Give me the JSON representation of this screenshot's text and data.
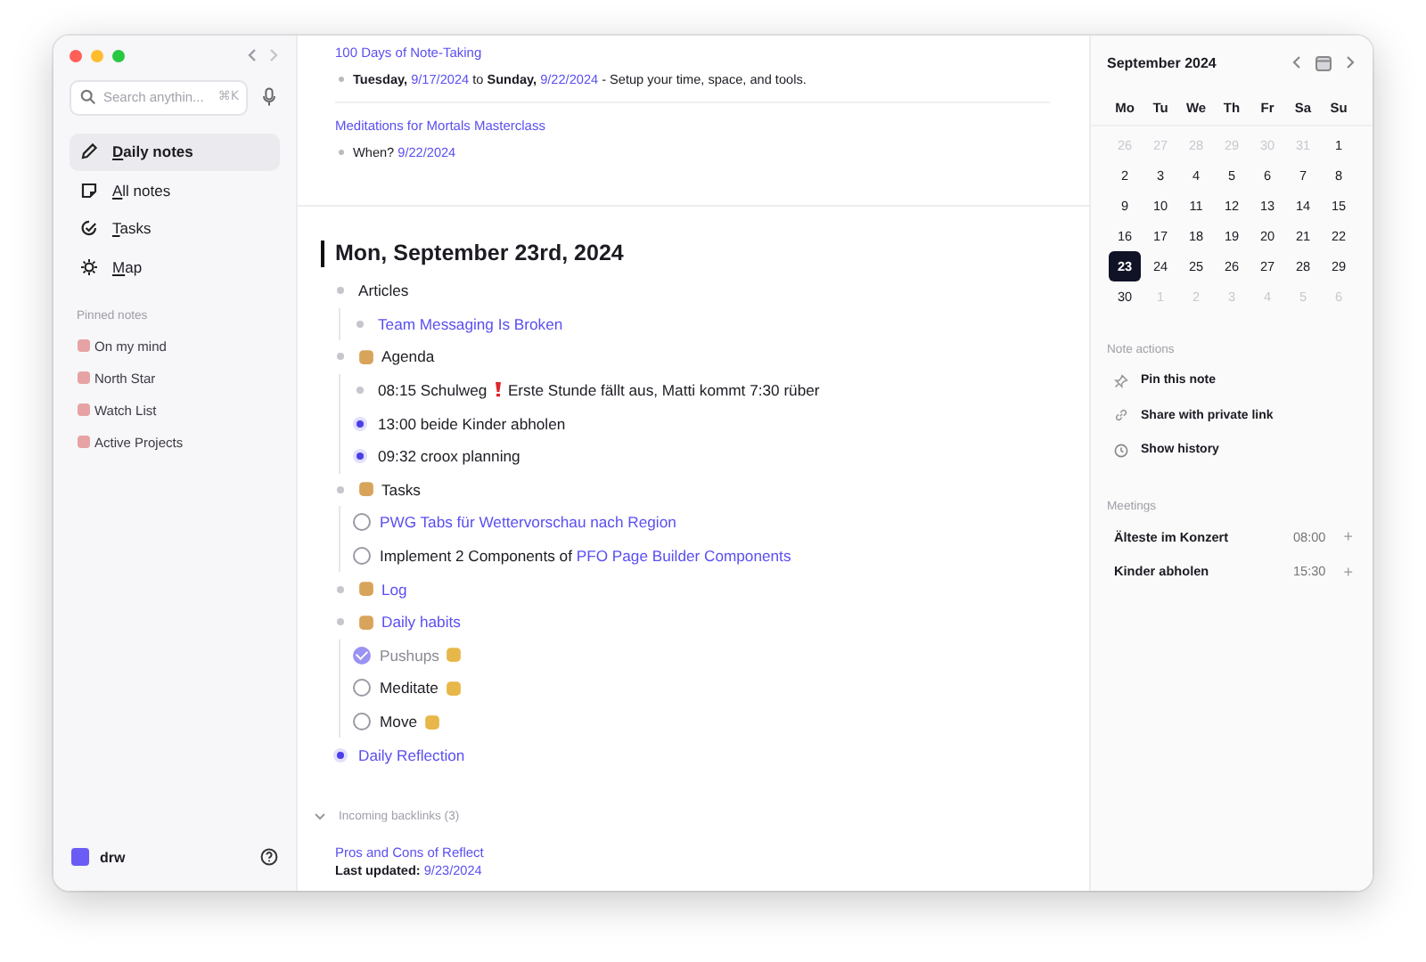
{
  "sidebar": {
    "search": {
      "placeholder": "Search anythin...",
      "shortcut": "⌘K"
    },
    "nav": [
      {
        "label": "Daily notes",
        "selected": true,
        "kind": "pencil"
      },
      {
        "label": "All notes",
        "selected": false,
        "kind": "note"
      },
      {
        "label": "Tasks",
        "selected": false,
        "kind": "tasks"
      },
      {
        "label": "Map",
        "selected": false,
        "kind": "map"
      }
    ],
    "pinned_heading": "Pinned notes",
    "pinned": [
      "On my mind",
      "North Star",
      "Watch List",
      "Active Projects"
    ],
    "user": "drw"
  },
  "previous_notes": [
    {
      "title": "100 Days of Note-Taking",
      "parts": [
        {
          "kind": "bold",
          "text": "Tuesday,"
        },
        {
          "kind": "link",
          "text": "9/17/2024"
        },
        {
          "kind": "text",
          "text": "to"
        },
        {
          "kind": "bold",
          "text": "Sunday,"
        },
        {
          "kind": "link",
          "text": "9/22/2024"
        },
        {
          "kind": "text",
          "text": "- Setup your time, space, and tools."
        }
      ]
    },
    {
      "title": "Meditations for Mortals Masterclass",
      "parts": [
        {
          "kind": "text",
          "text": "When?"
        },
        {
          "kind": "link",
          "text": "9/22/2024"
        }
      ]
    }
  ],
  "daily_note": {
    "title": "Mon, September 23rd, 2024",
    "outline": [
      {
        "kind": "bullet",
        "collapsed": false,
        "parts": [
          {
            "kind": "text",
            "text": "Articles"
          }
        ],
        "children": [
          {
            "kind": "bullet",
            "collapsed": false,
            "parts": [
              {
                "kind": "link",
                "text": "Team Messaging Is Broken"
              }
            ]
          }
        ]
      },
      {
        "kind": "emoji",
        "collapsed": false,
        "parts": [
          {
            "kind": "text",
            "text": "Agenda"
          }
        ],
        "children": [
          {
            "kind": "bullet",
            "collapsed": false,
            "parts": [
              {
                "kind": "text",
                "text": "08:15 Schulweg"
              },
              {
                "kind": "alert"
              },
              {
                "kind": "text",
                "text": "Erste Stunde fällt aus, Matti kommt 7:30 rüber"
              }
            ]
          },
          {
            "kind": "bullet",
            "collapsed": true,
            "parts": [
              {
                "kind": "text",
                "text": "13:00 beide Kinder abholen"
              }
            ]
          },
          {
            "kind": "bullet",
            "collapsed": true,
            "parts": [
              {
                "kind": "text",
                "text": "09:32 croox planning"
              }
            ]
          }
        ]
      },
      {
        "kind": "emoji",
        "collapsed": false,
        "parts": [
          {
            "kind": "text",
            "text": "Tasks"
          }
        ],
        "children": [
          {
            "kind": "task",
            "checked": false,
            "parts": [
              {
                "kind": "link",
                "text": "PWG Tabs für Wettervorschau nach Region"
              }
            ]
          },
          {
            "kind": "task",
            "checked": false,
            "parts": [
              {
                "kind": "text",
                "text": "Implement 2 Components of"
              },
              {
                "kind": "link",
                "text": "PFO Page Builder Components"
              }
            ]
          }
        ]
      },
      {
        "kind": "emoji",
        "collapsed": false,
        "parts": [
          {
            "kind": "link",
            "text": "Log"
          }
        ]
      },
      {
        "kind": "emoji",
        "collapsed": false,
        "parts": [
          {
            "kind": "link",
            "text": "Daily habits"
          }
        ],
        "children": [
          {
            "kind": "habit",
            "checked": true,
            "parts": [
              {
                "kind": "text",
                "text": "Pushups"
              }
            ]
          },
          {
            "kind": "habit",
            "checked": false,
            "parts": [
              {
                "kind": "text",
                "text": "Meditate"
              }
            ]
          },
          {
            "kind": "habit",
            "checked": false,
            "parts": [
              {
                "kind": "text",
                "text": "Move"
              }
            ]
          }
        ]
      },
      {
        "kind": "bullet",
        "collapsed": true,
        "parts": [
          {
            "kind": "link",
            "text": "Daily Reflection"
          }
        ]
      }
    ],
    "backlinks": {
      "label": "Incoming backlinks (3)",
      "expanded": true,
      "items": [
        {
          "title": "Pros and Cons of Reflect",
          "parts": [
            {
              "kind": "bold",
              "text": "Last updated:"
            },
            {
              "kind": "link",
              "text": "9/23/2024"
            }
          ]
        }
      ]
    }
  },
  "calendar": {
    "month": "September 2024",
    "weekdays": [
      "Mo",
      "Tu",
      "We",
      "Th",
      "Fr",
      "Sa",
      "Su"
    ],
    "days": [
      {
        "text": "26",
        "muted": true,
        "selected": false
      },
      {
        "text": "27",
        "muted": true,
        "selected": false
      },
      {
        "text": "28",
        "muted": true,
        "selected": false
      },
      {
        "text": "29",
        "muted": true,
        "selected": false
      },
      {
        "text": "30",
        "muted": true,
        "selected": false
      },
      {
        "text": "31",
        "muted": true,
        "selected": false
      },
      {
        "text": "1",
        "muted": false,
        "selected": false
      },
      {
        "text": "2",
        "muted": false,
        "selected": false
      },
      {
        "text": "3",
        "muted": false,
        "selected": false
      },
      {
        "text": "4",
        "muted": false,
        "selected": false
      },
      {
        "text": "5",
        "muted": false,
        "selected": false
      },
      {
        "text": "6",
        "muted": false,
        "selected": false
      },
      {
        "text": "7",
        "muted": false,
        "selected": false
      },
      {
        "text": "8",
        "muted": false,
        "selected": false
      },
      {
        "text": "9",
        "muted": false,
        "selected": false
      },
      {
        "text": "10",
        "muted": false,
        "selected": false
      },
      {
        "text": "11",
        "muted": false,
        "selected": false
      },
      {
        "text": "12",
        "muted": false,
        "selected": false
      },
      {
        "text": "13",
        "muted": false,
        "selected": false
      },
      {
        "text": "14",
        "muted": false,
        "selected": false
      },
      {
        "text": "15",
        "muted": false,
        "selected": false
      },
      {
        "text": "16",
        "muted": false,
        "selected": false
      },
      {
        "text": "17",
        "muted": false,
        "selected": false
      },
      {
        "text": "18",
        "muted": false,
        "selected": false
      },
      {
        "text": "19",
        "muted": false,
        "selected": false
      },
      {
        "text": "20",
        "muted": false,
        "selected": false
      },
      {
        "text": "21",
        "muted": false,
        "selected": false
      },
      {
        "text": "22",
        "muted": false,
        "selected": false
      },
      {
        "text": "23",
        "muted": false,
        "selected": true
      },
      {
        "text": "24",
        "muted": false,
        "selected": false
      },
      {
        "text": "25",
        "muted": false,
        "selected": false
      },
      {
        "text": "26",
        "muted": false,
        "selected": false
      },
      {
        "text": "27",
        "muted": false,
        "selected": false
      },
      {
        "text": "28",
        "muted": false,
        "selected": false
      },
      {
        "text": "29",
        "muted": false,
        "selected": false
      },
      {
        "text": "30",
        "muted": false,
        "selected": false
      },
      {
        "text": "1",
        "muted": true,
        "selected": false
      },
      {
        "text": "2",
        "muted": true,
        "selected": false
      },
      {
        "text": "3",
        "muted": true,
        "selected": false
      },
      {
        "text": "4",
        "muted": true,
        "selected": false
      },
      {
        "text": "5",
        "muted": true,
        "selected": false
      },
      {
        "text": "6",
        "muted": true,
        "selected": false
      }
    ]
  },
  "note_actions": {
    "heading": "Note actions",
    "items": [
      {
        "label": "Pin this note",
        "kind": "pin"
      },
      {
        "label": "Share with private link",
        "kind": "link"
      },
      {
        "label": "Show history",
        "kind": "history"
      }
    ]
  },
  "meetings": {
    "heading": "Meetings",
    "items": [
      {
        "title": "Älteste im Konzert",
        "time": "08:00",
        "action": "+"
      },
      {
        "title": "Kinder abholen",
        "time": "15:30",
        "action": "+"
      }
    ]
  }
}
